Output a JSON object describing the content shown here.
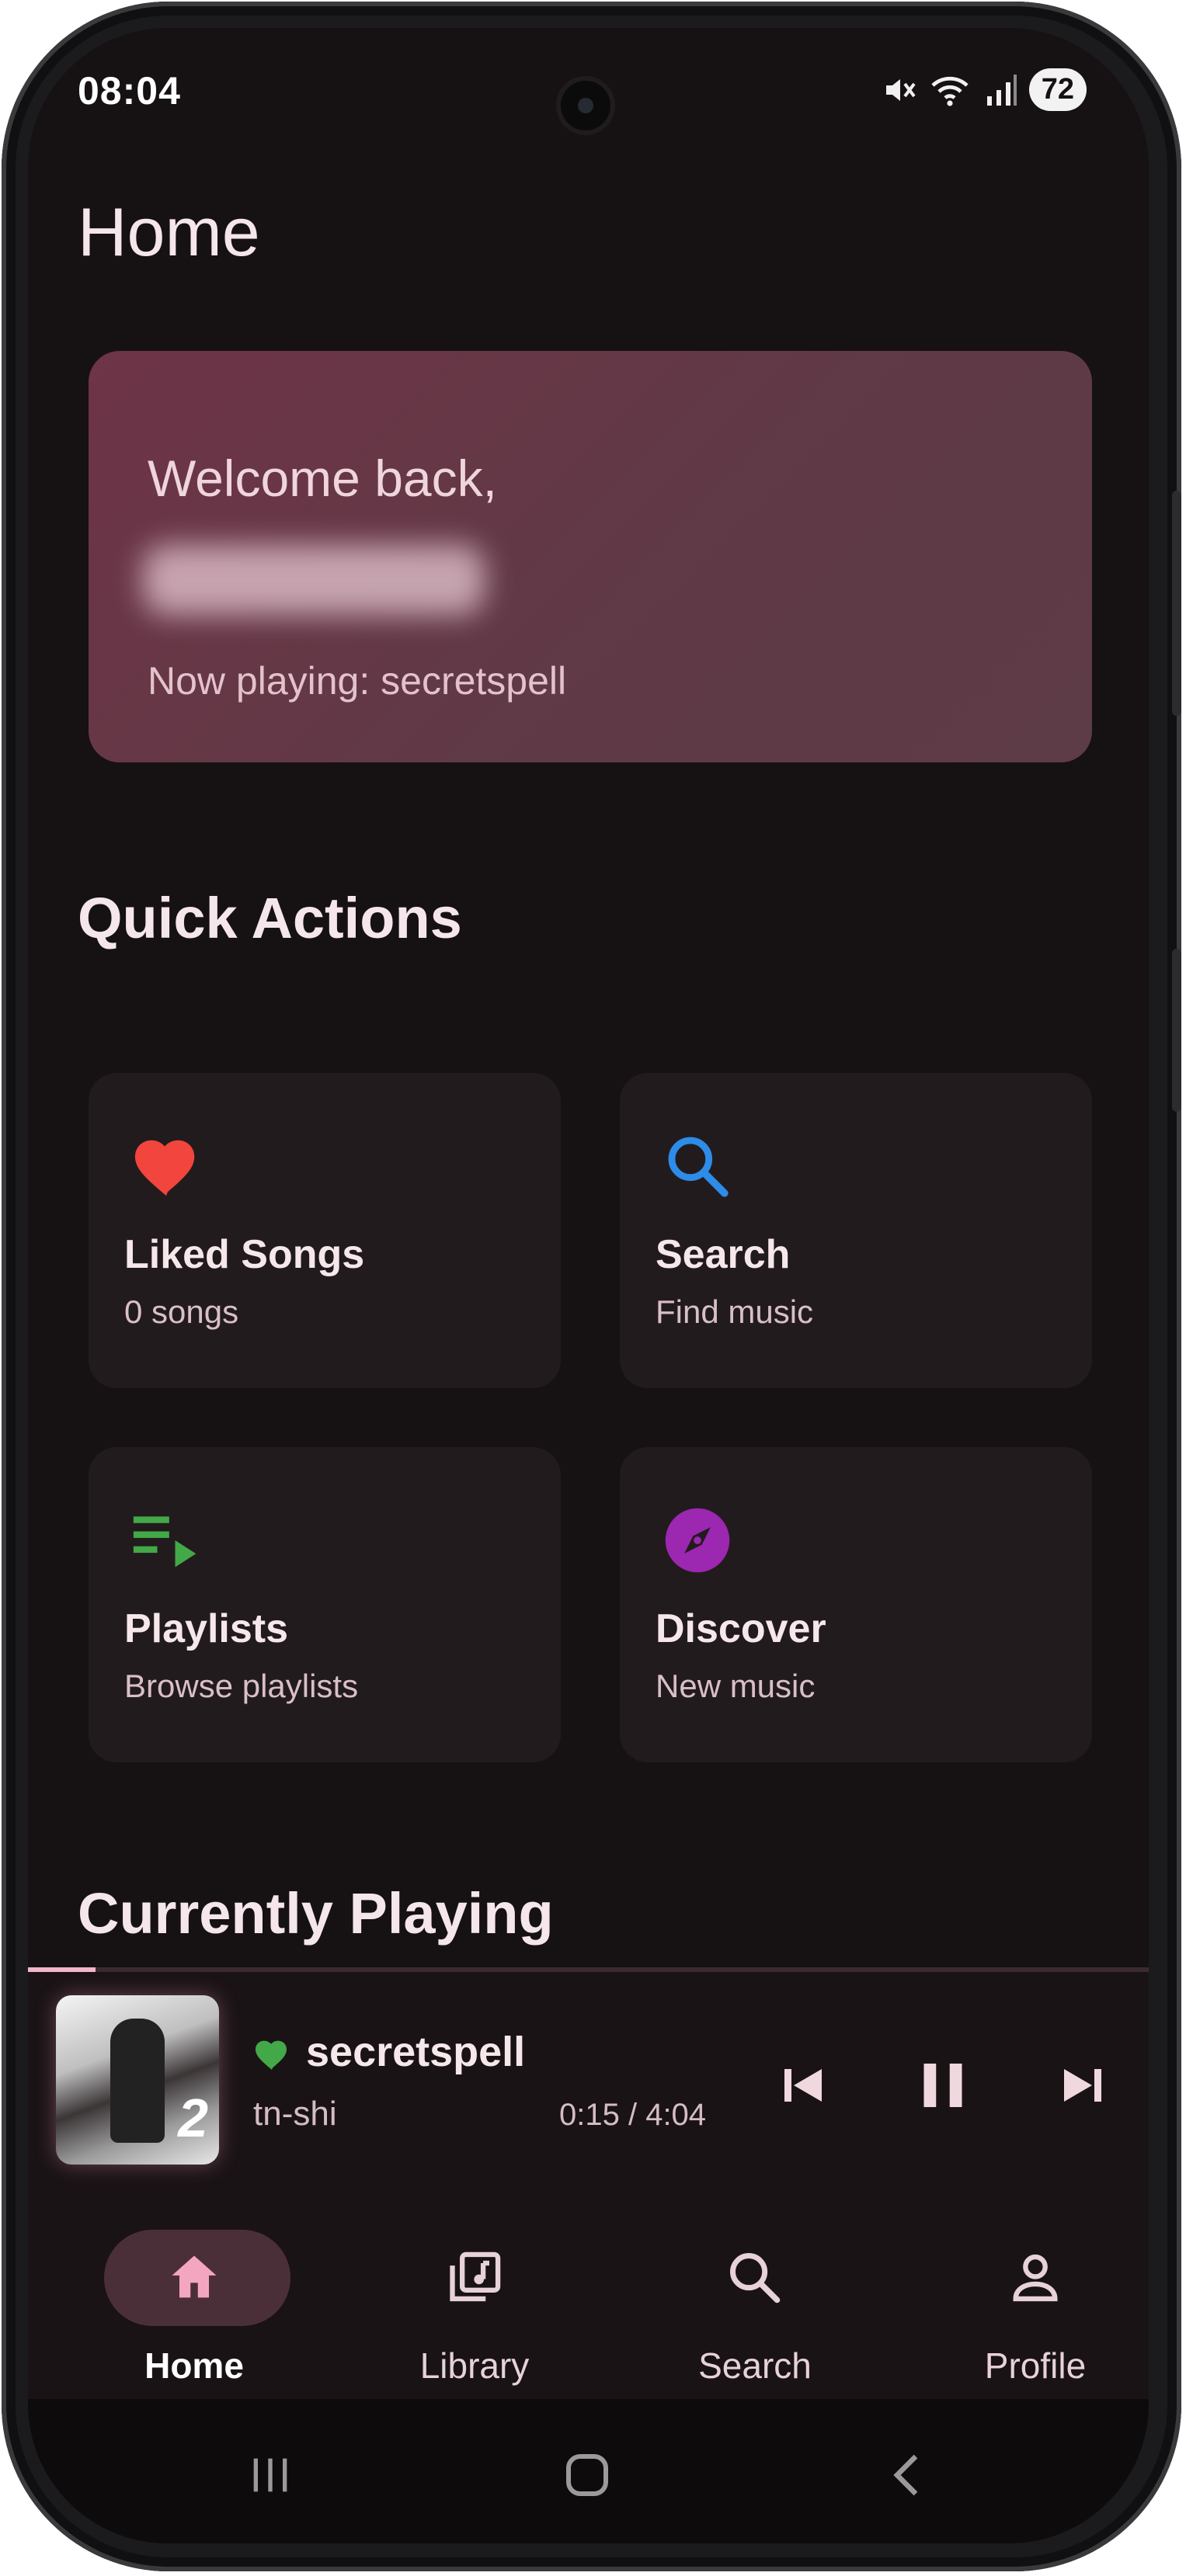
{
  "status_bar": {
    "time": "08:04",
    "battery": "72",
    "icons": [
      "mute-icon",
      "wifi-icon",
      "signal-icon"
    ]
  },
  "page": {
    "title": "Home"
  },
  "welcome": {
    "greeting": "Welcome back,",
    "now_playing": "Now playing: secretspell"
  },
  "quick_actions": {
    "title": "Quick Actions",
    "items": [
      {
        "title": "Liked Songs",
        "subtitle": "0 songs",
        "icon": "heart-icon",
        "color": "#f2453d"
      },
      {
        "title": "Search",
        "subtitle": "Find music",
        "icon": "search-icon",
        "color": "#2d8ce8"
      },
      {
        "title": "Playlists",
        "subtitle": "Browse playlists",
        "icon": "playlist-play-icon",
        "color": "#43a847"
      },
      {
        "title": "Discover",
        "subtitle": "New music",
        "icon": "compass-icon",
        "color": "#9c27b0"
      }
    ]
  },
  "currently_playing": {
    "title": "Currently Playing",
    "track": "secretspell",
    "artist": "tn-shi",
    "time": "0:15 / 4:04",
    "progress": 0.06,
    "liked_color": "#43a847"
  },
  "bottom_nav": {
    "items": [
      {
        "label": "Home",
        "icon": "home-icon",
        "active": true
      },
      {
        "label": "Library",
        "icon": "library-music-icon",
        "active": false
      },
      {
        "label": "Search",
        "icon": "search-icon",
        "active": false
      },
      {
        "label": "Profile",
        "icon": "person-icon",
        "active": false
      }
    ]
  },
  "colors": {
    "background": "#161113",
    "card": "#221b1d",
    "accent_pink": "#f2b5c9",
    "welcome_card": "#6e3447"
  }
}
